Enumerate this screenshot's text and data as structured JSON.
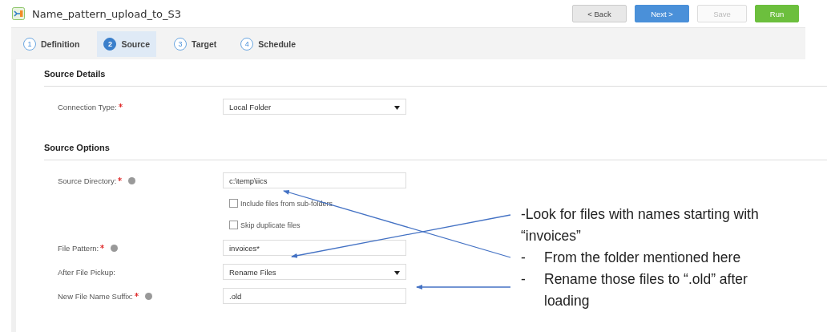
{
  "window": {
    "title": "Name_pattern_upload_to_S3"
  },
  "buttons": [
    {
      "label": "< Back",
      "kind": "secondary",
      "disabled": false
    },
    {
      "label": "Next >",
      "kind": "primary",
      "disabled": false
    },
    {
      "label": "Save",
      "kind": "secondary",
      "disabled": true
    },
    {
      "label": "Run",
      "kind": "run",
      "disabled": false
    }
  ],
  "steps": [
    {
      "number": "1",
      "label": "Definition",
      "selected": false
    },
    {
      "number": "2",
      "label": "Source",
      "selected": true
    },
    {
      "number": "3",
      "label": "Target",
      "selected": false
    },
    {
      "number": "4",
      "label": "Schedule",
      "selected": false
    }
  ],
  "sections": [
    {
      "title": "Source Details",
      "fields": [
        {
          "kind": "select",
          "label": "Connection Type:",
          "required": true,
          "help": false,
          "value": "Local Folder"
        }
      ]
    },
    {
      "title": "Source Options",
      "fields": [
        {
          "kind": "text",
          "label": "Source Directory:",
          "required": true,
          "help": true,
          "value": "c:\\temp\\iics"
        },
        {
          "kind": "checkbox",
          "label": "Include files from sub-folders",
          "checked": false
        },
        {
          "kind": "checkbox",
          "label": "Skip duplicate files",
          "checked": false
        },
        {
          "kind": "text",
          "label": "File Pattern:",
          "required": true,
          "help": true,
          "value": "invoices*"
        },
        {
          "kind": "select",
          "label": "After File Pickup:",
          "required": false,
          "help": false,
          "value": "Rename Files"
        },
        {
          "kind": "text",
          "label": "New File Name Suffix:",
          "required": true,
          "help": true,
          "value": ".old"
        }
      ]
    }
  ],
  "annotations": [
    {
      "kind": "plain",
      "text": "-Look for files with names starting with “invoices”"
    },
    {
      "kind": "bullet",
      "marker": "-",
      "text": "From the folder mentioned here"
    },
    {
      "kind": "bullet",
      "marker": "-",
      "text": "Rename those files to “.old” after loading"
    }
  ]
}
